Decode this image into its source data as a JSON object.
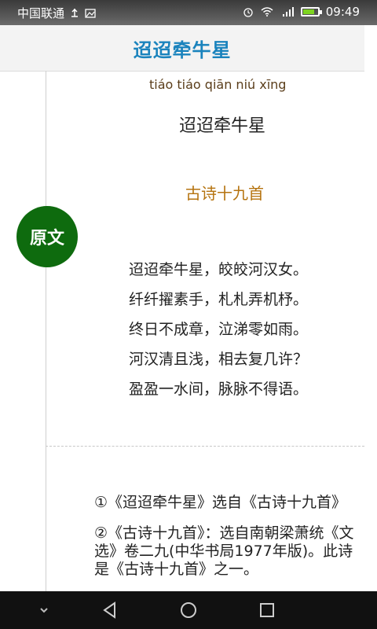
{
  "status_bar": {
    "carrier": "中国联通",
    "time": "09:49"
  },
  "header": {
    "title": "迢迢牵牛星"
  },
  "poem": {
    "pinyin": "tiáo tiáo qiān niú xīng",
    "title": "迢迢牵牛星",
    "source": "古诗十九首",
    "section_badge": "原文",
    "lines": [
      "迢迢牵牛星，皎皎河汉女。",
      "纤纤擢素手，札札弄机杼。",
      "终日不成章，泣涕零如雨。",
      "河汉清且浅，相去复几许？",
      "盈盈一水间，脉脉不得语。"
    ]
  },
  "notes": [
    "①《迢迢牵牛星》选自《古诗十九首》",
    "②《古诗十九首》：选自南朝梁萧统《文选》卷二九(中华书局1977年版)。此诗是《古诗十九首》之一。"
  ],
  "colors": {
    "header_title": "#1a83bd",
    "source": "#b5730f",
    "badge": "#0e6b0e"
  }
}
